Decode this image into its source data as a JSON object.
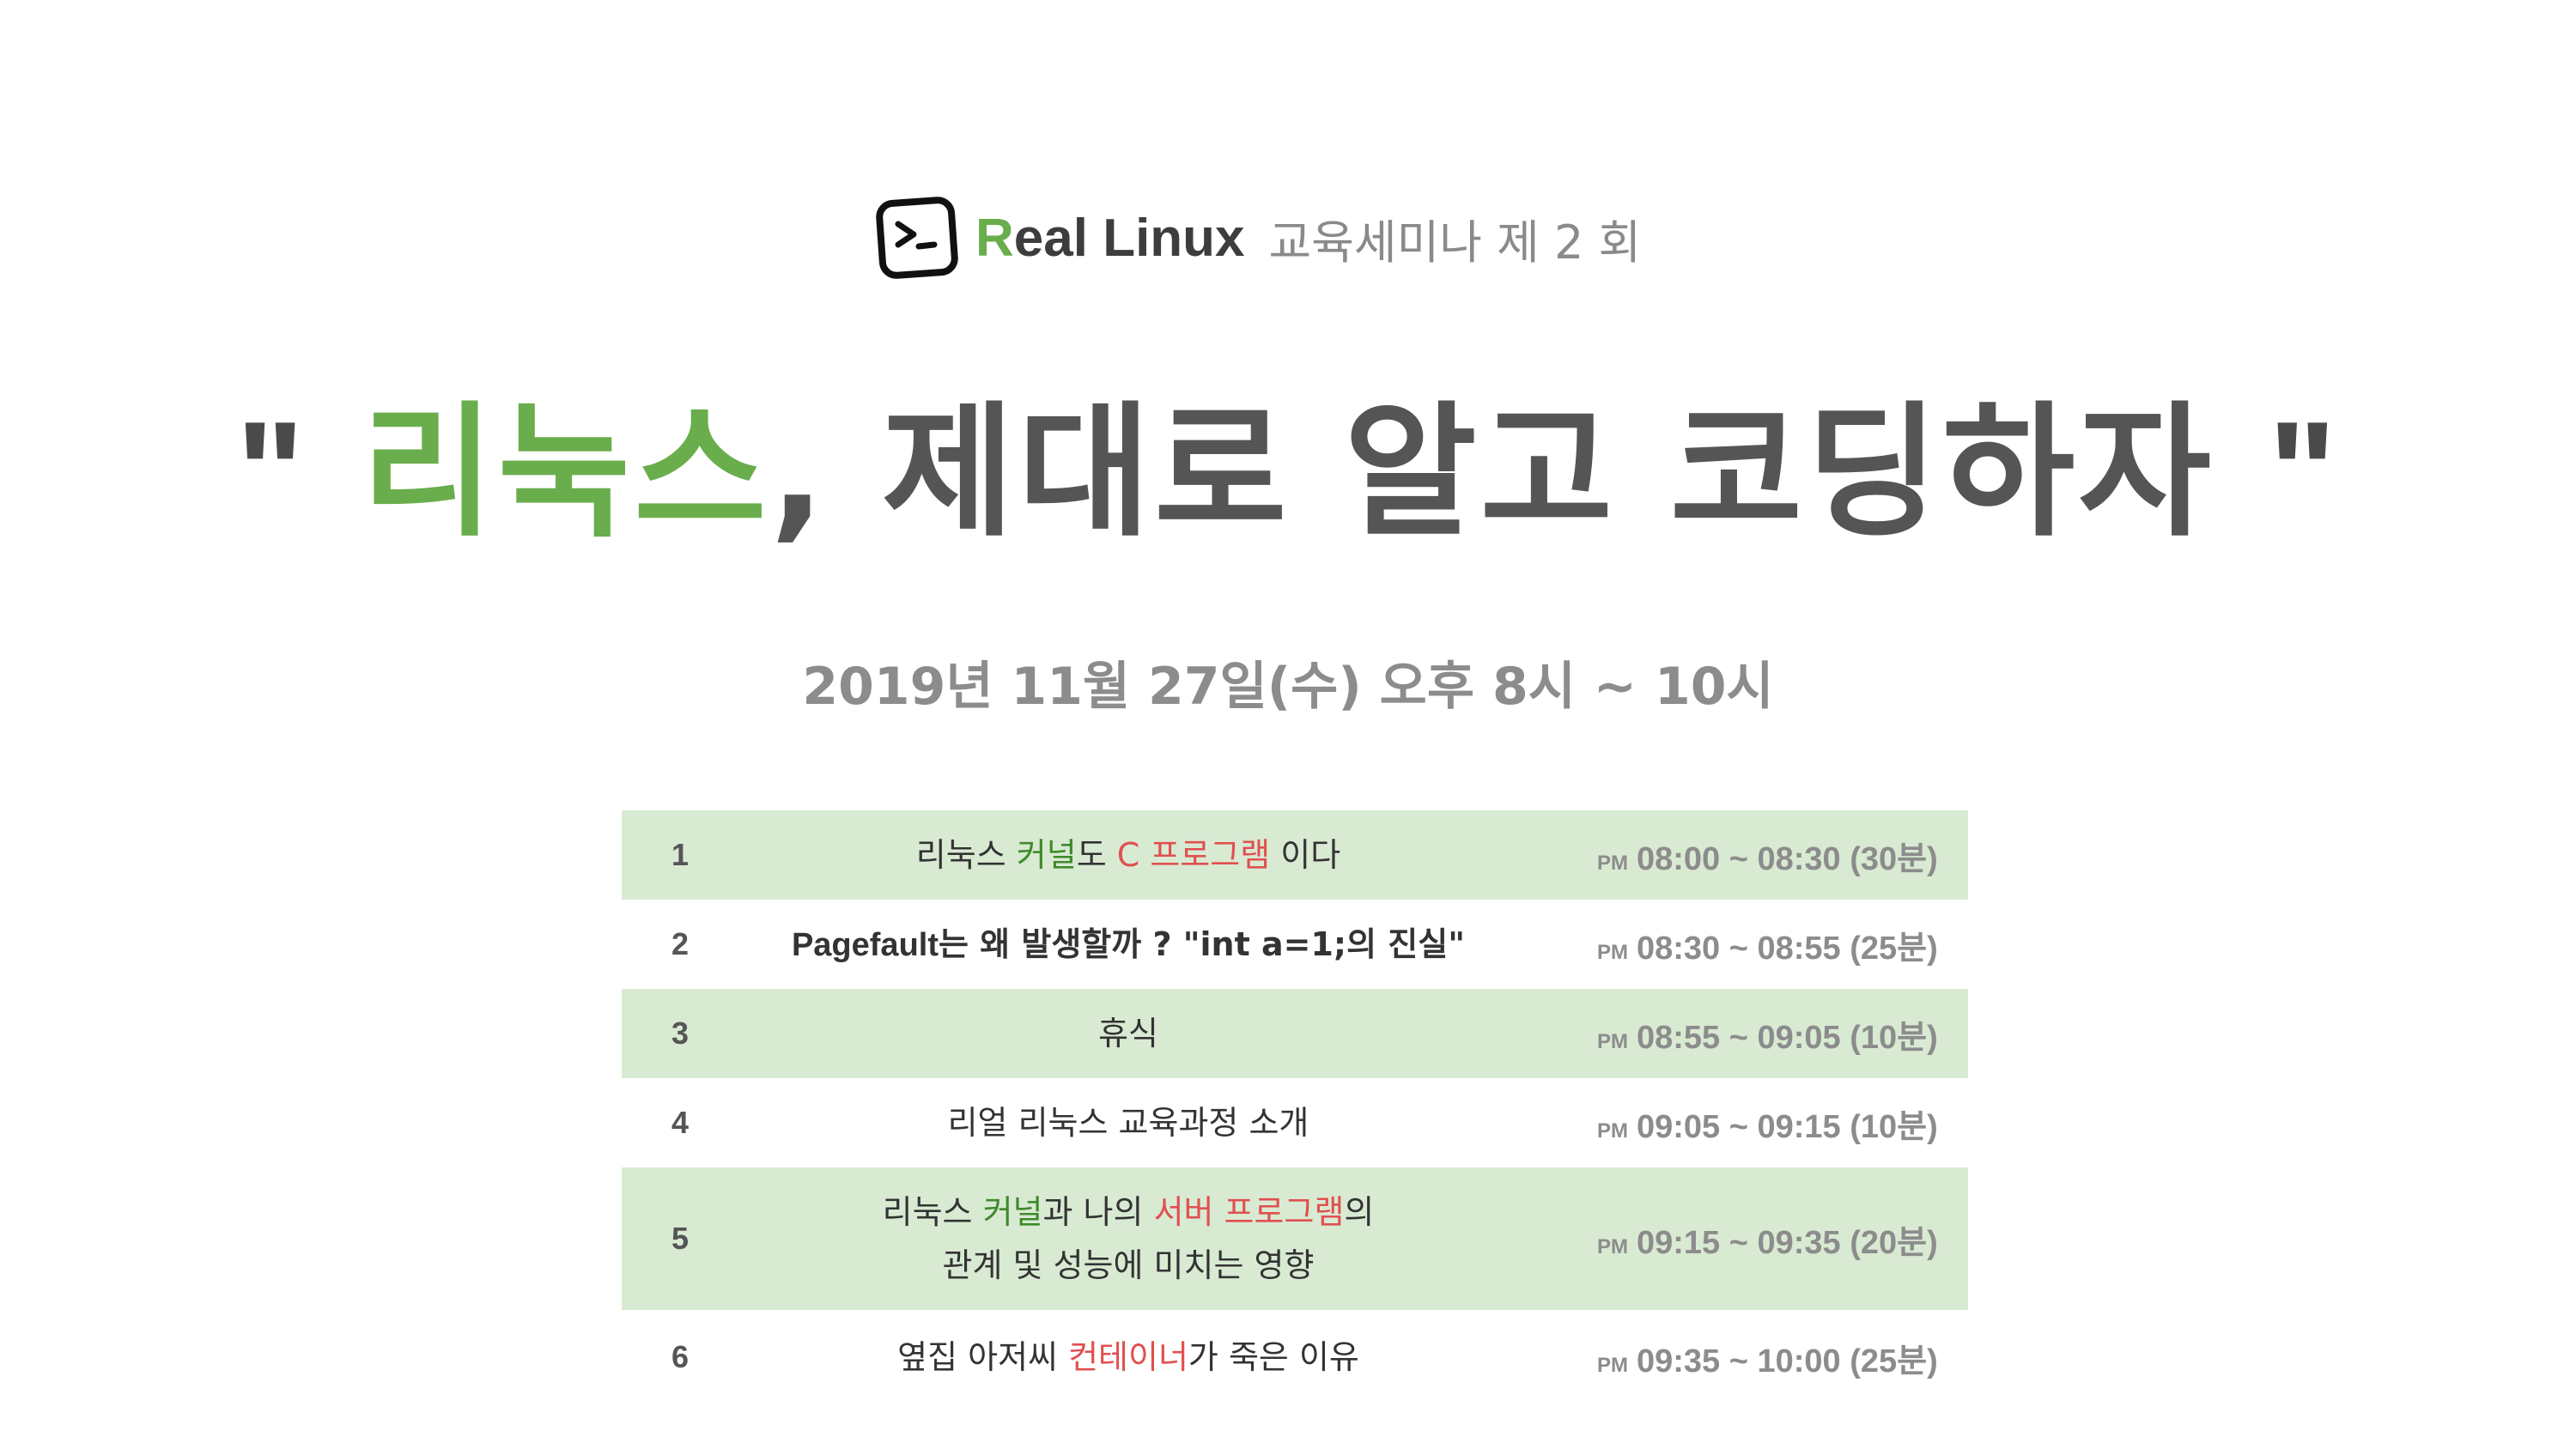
{
  "header": {
    "brand_initial": "R",
    "brand_rest": "eal Linux",
    "subtitle": "교육세미나 제 2 회"
  },
  "headline": {
    "open_quote": "\"",
    "green": "리눅스",
    "rest": ", 제대로 알고 코딩하자",
    "close_quote": "\""
  },
  "date": "2019년 11월 27일(수)  오후 8시 ~ 10시",
  "agenda": {
    "pm_label": "PM",
    "items": [
      {
        "num": "1",
        "title": {
          "a": "리눅스 ",
          "b": "커널",
          "c": "도 ",
          "d": "C 프로그램",
          "e": " 이다"
        },
        "time": "08:00 ~ 08:30 (30분)"
      },
      {
        "num": "2",
        "title": {
          "a": "Pagefault",
          "b": "는 왜 발생할까 ? \"int a=1;의 진실\""
        },
        "time": "08:30 ~ 08:55 (25분)"
      },
      {
        "num": "3",
        "title": {
          "a": "휴식"
        },
        "time": "08:55 ~ 09:05 (10분)"
      },
      {
        "num": "4",
        "title": {
          "a": "리얼 리눅스 교육과정 소개"
        },
        "time": "09:05 ~ 09:15 (10분)"
      },
      {
        "num": "5",
        "title": {
          "a": "리눅스 ",
          "b": "커널",
          "c": "과 나의 ",
          "d": "서버 프로그램",
          "e": "의",
          "line2": "관계 및 성능에 미치는 영향"
        },
        "time": "09:15 ~ 09:35 (20분)"
      },
      {
        "num": "6",
        "title": {
          "a": "옆집 아저씨 ",
          "b": "컨테이너",
          "c": "가 죽은 이유"
        },
        "time": "09:35 ~ 10:00 (25분)"
      }
    ]
  },
  "colors": {
    "green_brand": "#6aad4d",
    "kernel_green": "#3f8a2a",
    "accent_red": "#e05050",
    "row_shade": "#d9ead3",
    "gray_text": "#8c8c8c"
  }
}
